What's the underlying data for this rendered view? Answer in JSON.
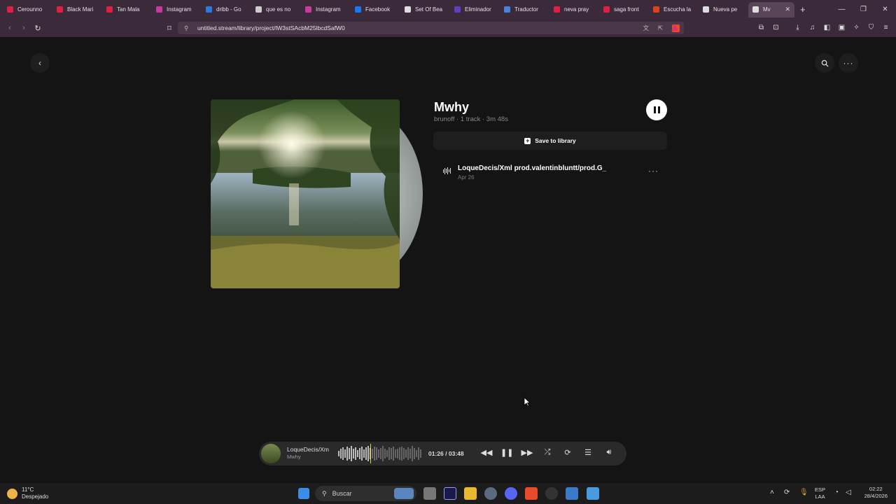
{
  "browser": {
    "tabs": [
      {
        "label": "Cerounno",
        "color": "#e02040"
      },
      {
        "label": "Black Mari",
        "color": "#e02040"
      },
      {
        "label": "Tan Mala",
        "color": "#e02040"
      },
      {
        "label": "Instagram",
        "color": "#c83aa0"
      },
      {
        "label": "dribb - Go",
        "color": "#2a7ae2"
      },
      {
        "label": "que es no",
        "color": "#cccccc"
      },
      {
        "label": "Instagram",
        "color": "#c83aa0"
      },
      {
        "label": "Facebook",
        "color": "#1877f2"
      },
      {
        "label": "Set Of Bea",
        "color": "#dddddd"
      },
      {
        "label": "Eliminador",
        "color": "#6040c0"
      },
      {
        "label": "Traductor",
        "color": "#4a80e0"
      },
      {
        "label": "neva pray",
        "color": "#e02040"
      },
      {
        "label": "saga front",
        "color": "#e02040"
      },
      {
        "label": "Escucha la",
        "color": "#e04020"
      },
      {
        "label": "Nueva pe",
        "color": "#dddddd"
      },
      {
        "label": "Mv",
        "color": "#dddddd",
        "active": true
      }
    ],
    "new_tab": "+",
    "url": "untitled.stream/library/project/lW3stSAcbM25lbcdSafW0"
  },
  "project": {
    "title": "Mwhy",
    "meta": "brunoff · 1 track · 3m 48s",
    "save_label": "Save to library",
    "tracks": [
      {
        "name": "LoqueDecis/Xml prod.valentinbluntt/prod.G_",
        "date": "Apr 26"
      }
    ]
  },
  "player": {
    "track_name": "LoqueDecis/Xml",
    "project_name": "Mwhy",
    "current_time": "01:26",
    "separator": "/",
    "total_time": "03:48",
    "progress_fraction": 0.38
  },
  "taskbar": {
    "temperature": "11°C",
    "condition": "Despejado",
    "search_placeholder": "Buscar",
    "lang_top": "ESP",
    "lang_bottom": "LAA",
    "time": "02:22",
    "date": "28/4/2026"
  }
}
